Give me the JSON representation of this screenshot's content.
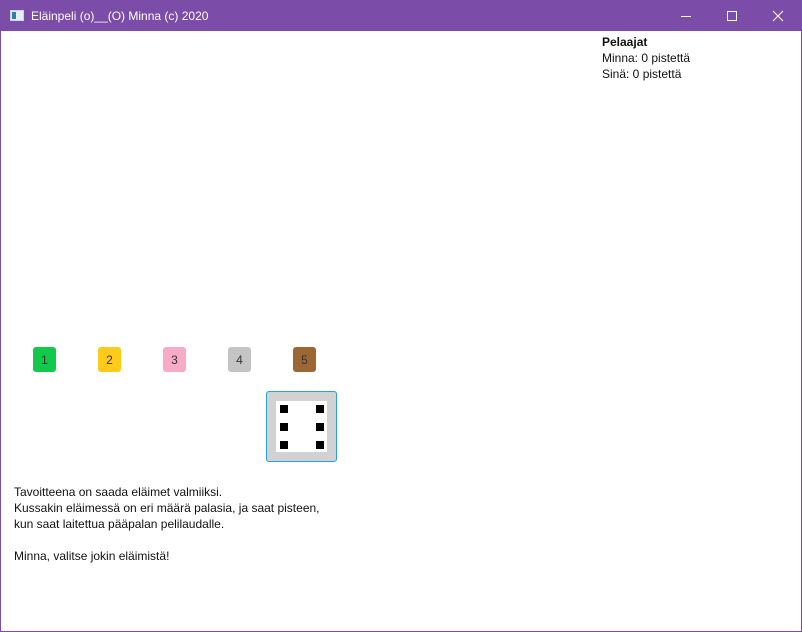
{
  "window": {
    "title": "Eläinpeli (o)__(O) Minna (c) 2020",
    "titlebar_color": "#7b4ca8",
    "controls": {
      "minimize_icon": "minimize-icon",
      "maximize_icon": "maximize-icon",
      "close_icon": "close-icon"
    }
  },
  "players": {
    "heading": "Pelaajat",
    "lines": [
      "Minna: 0 pistettä",
      "Sinä: 0 pistettä"
    ]
  },
  "animals": [
    {
      "label": "1",
      "color": "#12c94a"
    },
    {
      "label": "2",
      "color": "#fecb1a"
    },
    {
      "label": "3",
      "color": "#f8aac6"
    },
    {
      "label": "4",
      "color": "#c4c4c4"
    },
    {
      "label": "5",
      "color": "#9d6733"
    }
  ],
  "dice": {
    "face_value": 6,
    "icon": "dice-six-icon"
  },
  "instructions": {
    "lines": [
      "Tavoitteena on saada eläimet valmiiksi.",
      "Kussakin eläimessä on eri määrä palasia, ja saat pisteen,",
      "kun saat laitettua pääpalan pelilaudalle."
    ],
    "prompt": "Minna, valitse jokin eläimistä!"
  }
}
